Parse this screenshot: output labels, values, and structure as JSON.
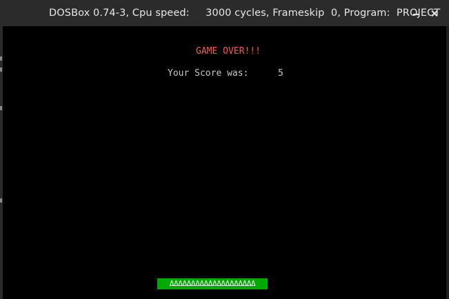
{
  "window": {
    "title": "DOSBox 0.74-3, Cpu speed:     3000 cycles, Frameskip  0, Program:  PROJECT",
    "minimize_icon": "minimize-icon",
    "close_icon": "close-icon"
  },
  "game": {
    "game_over_text": "GAME OVER!!!",
    "score_label": "Your Score was:",
    "score_value": "5",
    "paddle_glyphs": "ΔΔΔΔΔΔΔΔΔΔΔΔΔΔΔΔΔΔΔΔ",
    "colors": {
      "game_over": "#ff5555",
      "score": "#c8c8c8",
      "paddle_bg": "#00aa00",
      "screen_bg": "#000000"
    }
  }
}
